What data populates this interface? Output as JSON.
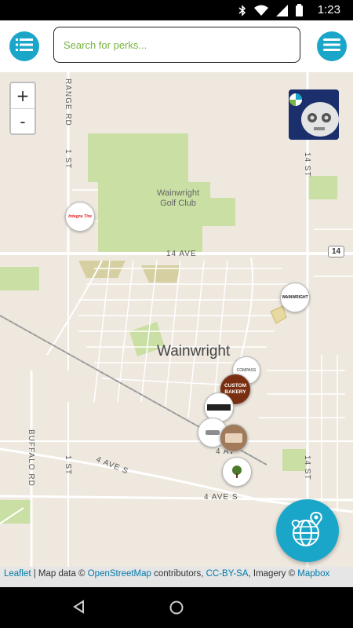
{
  "status_bar": {
    "time": "1:23"
  },
  "search": {
    "placeholder": "Search for perks..."
  },
  "map": {
    "zoom_in": "+",
    "zoom_out": "-",
    "labels": {
      "golf_line1": "Wainwright",
      "golf_line2": "Golf Club",
      "town": "Wainwright",
      "range_rd": "RANGE RD",
      "first_st_top": "1 ST",
      "first_st_bottom": "1 ST",
      "fourteenth_ave": "14 AVE",
      "hwy_14": "14",
      "fourteenth_st_top": "14 ST",
      "fourteenth_st_bottom": "14 ST",
      "buffalo_rd": "BUFFALO RD",
      "fourth_ave_s_left": "4 AVE S",
      "fourth_ave_s_bottom": "4 AVE S",
      "fourth_ave_mid": "4 AV"
    },
    "markers": {
      "integra": "Integra Tire",
      "wainwright_shop": "WAINWRIGHT",
      "compass": "COMPASS",
      "bakery_line1": "CUSTOM",
      "bakery_line2": "BAKERY"
    }
  },
  "attribution": {
    "leaflet": "Leaflet",
    "sep1": " | Map data © ",
    "osm": "OpenStreetMap",
    "sep2": " contributors, ",
    "license": "CC-BY-SA",
    "sep3": ", Imagery © ",
    "mapbox": "Mapbox"
  },
  "colors": {
    "accent": "#1aa6c9",
    "park": "#c9dfa3",
    "road": "#ffffff",
    "highway_label": "#7ab341"
  }
}
